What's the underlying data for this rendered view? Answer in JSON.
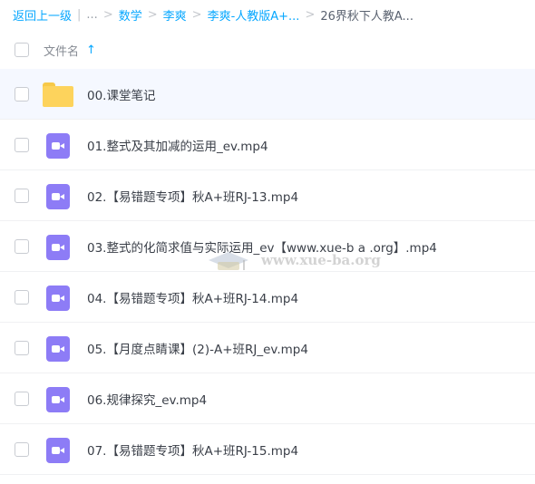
{
  "breadcrumb": {
    "back_label": "返回上一级",
    "divider": "|",
    "ellipsis": "...",
    "separator": ">",
    "items": [
      "数学",
      "李爽",
      "李爽-人教版A+...",
      "26界秋下人教A..."
    ]
  },
  "header": {
    "column_title": "文件名",
    "sort_arrow": "↑"
  },
  "files": [
    {
      "name": "00.课堂笔记",
      "type": "folder-icon"
    },
    {
      "name": "01.整式及其加减的运用_ev.mp4",
      "type": "video-icon"
    },
    {
      "name": "02.【易错题专项】秋A+班RJ-13.mp4",
      "type": "video-icon"
    },
    {
      "name": "03.整式的化简求值与实际运用_ev【www.xue-b a .org】.mp4",
      "type": "video-icon"
    },
    {
      "name": "04.【易错题专项】秋A+班RJ-14.mp4",
      "type": "video-icon"
    },
    {
      "name": "05.【月度点睛课】(2)-A+班RJ_ev.mp4",
      "type": "video-icon"
    },
    {
      "name": "06.规律探究_ev.mp4",
      "type": "video-icon"
    },
    {
      "name": "07.【易错题专项】秋A+班RJ-15.mp4",
      "type": "video-icon"
    }
  ],
  "watermark": {
    "text": "www.xue-ba.org"
  },
  "colors": {
    "link": "#06a7ff",
    "folder": "#fdd35c",
    "video": "#8d7cf6",
    "highlight_row": "#f5f8ff"
  }
}
